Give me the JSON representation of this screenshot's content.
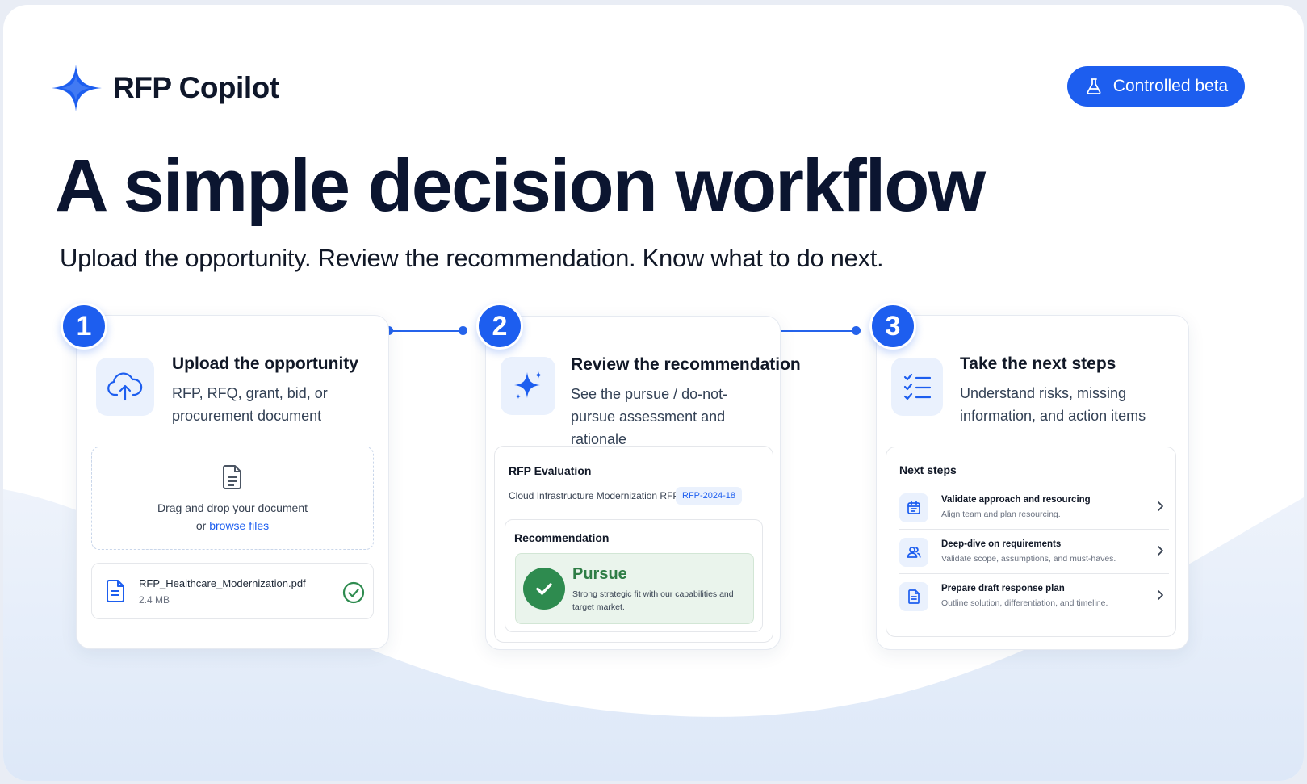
{
  "brand": {
    "name": "RFP Copilot",
    "logo_icon": "sparkle-icon"
  },
  "badge": {
    "label": "Controlled beta",
    "icon": "flask-icon"
  },
  "headline": "A simple decision workflow",
  "subline": "Upload the opportunity. Review the recommendation. Know what to do next.",
  "colors": {
    "accent": "#1d5eef",
    "success": "#2e8b4f",
    "ink": "#0b1530"
  },
  "steps": [
    {
      "number": "1",
      "title": "Upload the opportunity",
      "description": "RFP, RFQ, grant, bid, or procurement document",
      "icon": "cloud-upload-icon"
    },
    {
      "number": "2",
      "title": "Review the recommendation",
      "description": "See the pursue / do-not-pursue assessment and rationale",
      "icon": "sparkle-icon"
    },
    {
      "number": "3",
      "title": "Take the next steps",
      "description": "Understand risks, missing information, and action items",
      "icon": "checklist-icon"
    }
  ],
  "upload": {
    "drop_text": "Drag and drop your document",
    "or_text": "or",
    "browse_link": "browse files",
    "file": {
      "name": "RFP_Healthcare_Modernization.pdf",
      "size": "2.4 MB",
      "status_icon": "check-circle-icon"
    }
  },
  "evaluation": {
    "title": "RFP Evaluation",
    "rfp_name": "Cloud Infrastructure Modernization RFP",
    "rfp_id": "RFP-2024-18",
    "recommendation_label": "Recommendation",
    "decision": "Pursue",
    "rationale": "Strong strategic fit with our capabilities and target market."
  },
  "next_steps": {
    "title": "Next steps",
    "items": [
      {
        "title": "Validate approach and resourcing",
        "subtitle": "Align team and plan resourcing.",
        "icon": "calendar-icon"
      },
      {
        "title": "Deep-dive on requirements",
        "subtitle": "Validate scope, assumptions, and must-haves.",
        "icon": "users-icon"
      },
      {
        "title": "Prepare draft response plan",
        "subtitle": "Outline solution, differentiation, and timeline.",
        "icon": "document-icon"
      }
    ]
  }
}
